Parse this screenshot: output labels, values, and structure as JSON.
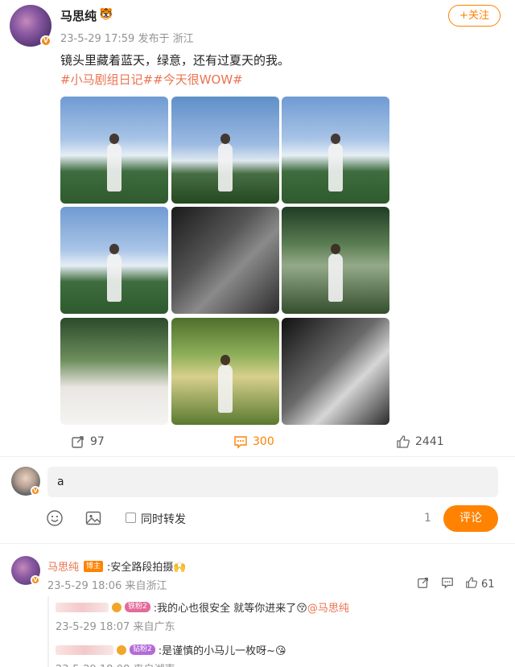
{
  "post": {
    "author": "马思纯",
    "author_emoji": "🐯",
    "meta": "23-5-29 17:59 发布于 浙江",
    "follow_label": "+关注",
    "text": "镜头里藏着蓝天，绿意，还有过夏天的我。",
    "tags": "#小马剧组日记##今天很WOW#",
    "photos": [
      "sky",
      "sky2",
      "sky",
      "sky",
      "bw",
      "tree",
      "portrait",
      "garden",
      "bw2"
    ]
  },
  "actions": {
    "repost_count": "97",
    "comment_count": "300",
    "like_count": "2441"
  },
  "composer": {
    "input_value": "a",
    "repost_label": "同时转发",
    "char_count": "1",
    "submit_label": "评论"
  },
  "comments": [
    {
      "author": "马思纯",
      "badge": "博主",
      "text": ":安全路段拍摄🙌",
      "meta": "23-5-29 18:06 来自浙江",
      "like_count": "61",
      "replies": [
        {
          "fan_tag": "铁粉2",
          "text": ":我的心也很安全 就等你进来了😚",
          "mention": "@马思纯",
          "meta": "23-5-29 18:07 来自广东"
        },
        {
          "fan_tag": "钻粉2",
          "text": ":是谨慎的小马儿一枚呀~😘",
          "meta": "23-5-29 18:08 来自湖南"
        }
      ]
    }
  ],
  "colors": {
    "accent": "#ff8200",
    "link": "#eb7350",
    "muted": "#939393"
  }
}
